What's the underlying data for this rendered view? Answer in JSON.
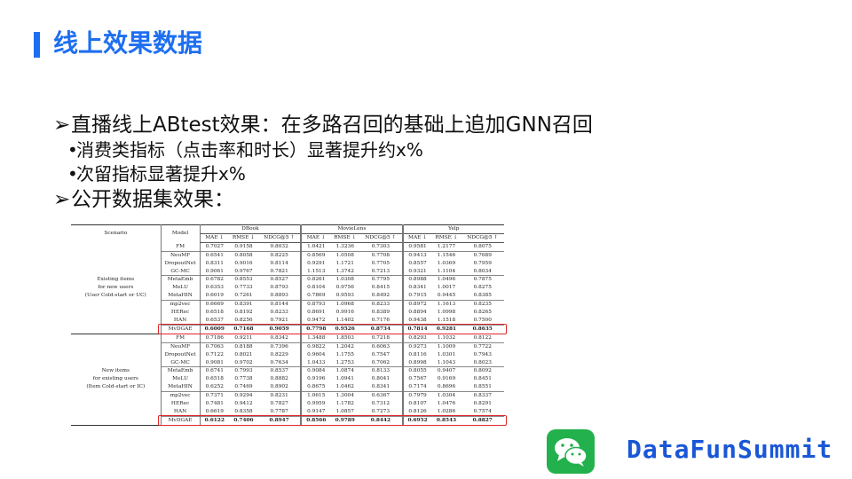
{
  "slide": {
    "title": "线上效果数据",
    "bullets": [
      {
        "level": 1,
        "marker": "➢",
        "text": "直播线上ABtest效果：在多路召回的基础上追加GNN召回"
      },
      {
        "level": 2,
        "marker": "•",
        "text": "消费类指标（点击率和时长）显著提升约x%"
      },
      {
        "level": 2,
        "marker": "•",
        "text": "次留指标显著提升x%"
      },
      {
        "level": 1,
        "marker": "➢",
        "text": "公开数据集效果："
      }
    ]
  },
  "table": {
    "scenario_header": "Scenario",
    "model_header": "Model",
    "datasets": [
      "DBook",
      "MovieLens",
      "Yelp"
    ],
    "metrics": [
      "MAE ↓",
      "RMSE ↓",
      "NDCG@5 ↑"
    ],
    "sections": [
      {
        "scenario_lines": [
          "Existing items",
          "for new users",
          "(User Cold-start or UC)"
        ],
        "rows": [
          {
            "model": "FM",
            "values": [
              "0.7027",
              "0.9158",
              "0.8032",
              "1.0421",
              "1.3236",
              "0.7303",
              "0.9581",
              "1.2177",
              "0.8075"
            ]
          },
          {
            "model": "NeuMF",
            "values": [
              "0.6541",
              "0.8058",
              "0.8225",
              "0.8569",
              "1.0508",
              "0.7708",
              "0.9413",
              "1.1546",
              "0.7689"
            ]
          },
          {
            "model": "DropoutNet",
            "values": [
              "0.8311",
              "0.9016",
              "0.8114",
              "0.9291",
              "1.1721",
              "0.7705",
              "0.8557",
              "1.0369",
              "0.7959"
            ]
          },
          {
            "model": "GC-MC",
            "values": [
              "0.9061",
              "0.9767",
              "0.7821",
              "1.1513",
              "1.3742",
              "0.7213",
              "0.9321",
              "1.1104",
              "0.8034"
            ]
          },
          {
            "model": "MetaEmb",
            "values": [
              "0.6782",
              "0.8553",
              "0.8527",
              "0.8261",
              "1.0308",
              "0.7795",
              "0.8988",
              "1.0496",
              "0.7875"
            ]
          },
          {
            "model": "MeLU",
            "values": [
              "0.6353",
              "0.7733",
              "0.8793",
              "0.8104",
              "0.9756",
              "0.8415",
              "0.8341",
              "1.0017",
              "0.8275"
            ]
          },
          {
            "model": "MetaHIN",
            "values": [
              "0.6019",
              "0.7261",
              "0.8893",
              "0.7869",
              "0.9593",
              "0.8492",
              "0.7915",
              "0.9445",
              "0.8385"
            ]
          },
          {
            "model": "mp2vec",
            "values": [
              "0.6669",
              "0.8391",
              "0.8144",
              "0.8793",
              "1.0968",
              "0.8233",
              "0.8972",
              "1.1613",
              "0.8235"
            ]
          },
          {
            "model": "HERec",
            "values": [
              "0.6518",
              "0.8192",
              "0.8233",
              "0.8691",
              "0.9916",
              "0.8389",
              "0.8894",
              "1.0998",
              "0.8265"
            ]
          },
          {
            "model": "HAN",
            "values": [
              "0.6537",
              "0.8256",
              "0.7921",
              "0.9472",
              "1.1402",
              "0.7176",
              "0.9438",
              "1.1518",
              "0.7500"
            ]
          }
        ],
        "highlight": {
          "model": "MvDGAE",
          "values": [
            "0.6009",
            "0.7168",
            "0.9059",
            "0.7798",
            "0.9526",
            "0.8734",
            "0.7814",
            "0.9281",
            "0.8635"
          ]
        }
      },
      {
        "scenario_lines": [
          "New items",
          "for existing users",
          "(Item Cold-start or IC)"
        ],
        "rows": [
          {
            "model": "FM",
            "values": [
              "0.7186",
              "0.9211",
              "0.8342",
              "1.3488",
              "1.8503",
              "0.7218",
              "0.8293",
              "1.1032",
              "0.8122"
            ]
          },
          {
            "model": "NeuMF",
            "values": [
              "0.7063",
              "0.8188",
              "0.7396",
              "0.9822",
              "1.2042",
              "0.6063",
              "0.9273",
              "1.1009",
              "0.7722"
            ]
          },
          {
            "model": "DropoutNet",
            "values": [
              "0.7122",
              "0.8021",
              "0.8229",
              "0.9604",
              "1.1755",
              "0.7547",
              "0.8116",
              "1.0301",
              "0.7943"
            ]
          },
          {
            "model": "GC-MC",
            "values": [
              "0.9081",
              "0.9702",
              "0.7634",
              "1.0433",
              "1.2753",
              "0.7062",
              "0.8998",
              "1.1043",
              "0.8023"
            ]
          },
          {
            "model": "MetaEmb",
            "values": [
              "0.6741",
              "0.7993",
              "0.8537",
              "0.9084",
              "1.0874",
              "0.8133",
              "0.8055",
              "0.9407",
              "0.8092"
            ]
          },
          {
            "model": "MeLU",
            "values": [
              "0.6518",
              "0.7738",
              "0.8882",
              "0.9196",
              "1.0941",
              "0.8041",
              "0.7567",
              "0.9169",
              "0.8451"
            ]
          },
          {
            "model": "MetaHIN",
            "values": [
              "0.6252",
              "0.7469",
              "0.8902",
              "0.8675",
              "1.0462",
              "0.8341",
              "0.7174",
              "0.8696",
              "0.8551"
            ]
          },
          {
            "model": "mp2vec",
            "values": [
              "0.7371",
              "0.9294",
              "0.8231",
              "1.0615",
              "1.3004",
              "0.6367",
              "0.7979",
              "1.0304",
              "0.8337"
            ]
          },
          {
            "model": "HERec",
            "values": [
              "0.7481",
              "0.9412",
              "0.7827",
              "0.9959",
              "1.1782",
              "0.7312",
              "0.8107",
              "1.0476",
              "0.8291"
            ]
          },
          {
            "model": "HAN",
            "values": [
              "0.6619",
              "0.8358",
              "0.7787",
              "0.9147",
              "1.0857",
              "0.7273",
              "0.8126",
              "1.0286",
              "0.7574"
            ]
          }
        ],
        "highlight": {
          "model": "MvDGAE",
          "values": [
            "0.6122",
            "0.7406",
            "0.8947",
            "0.8566",
            "0.9789",
            "0.8442",
            "0.6952",
            "0.8543",
            "0.8827"
          ]
        }
      }
    ]
  },
  "brand": {
    "name": "DataFunSummit",
    "logo_icon": "wechat-logo-icon",
    "accent": "#1e6ff0",
    "highlight_color": "#e0262b"
  }
}
